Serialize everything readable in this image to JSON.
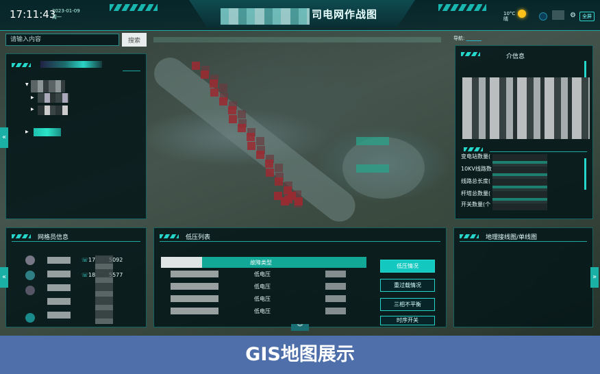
{
  "header": {
    "time": "17:11:43",
    "date": "2023-01-09",
    "weekday": "周一",
    "title_visible": "司电网作战图",
    "temperature": "10°C",
    "weather": "晴",
    "fullscreen_label": "全屏"
  },
  "search": {
    "placeholder": "请输入内容",
    "button_label": "搜索"
  },
  "nav": {
    "label": "导航:"
  },
  "left_panel": {},
  "right_top_panel": {
    "title_visible": "介信息",
    "stats": [
      "变电站数量(",
      "10KV线路数",
      "线路总长度(",
      "杆塔总数量(",
      "开关数量(个"
    ]
  },
  "gridman_panel": {
    "title": "网格员信息",
    "phones": [
      "17",
      "5092",
      "18",
      "5577"
    ]
  },
  "lowvoltage_panel": {
    "title": "低压列表",
    "column_fault_type": "故障类型",
    "rows": [
      "低电压",
      "低电压",
      "低电压",
      "低电压"
    ],
    "buttons": [
      "低压情况",
      "重过载情况",
      "三相不平衡",
      "时序开关"
    ],
    "active_button_index": 0
  },
  "topology_panel": {
    "title": "地理接线图/单线图"
  },
  "caption": "GIS地图展示",
  "colors": {
    "accent": "#1ea9a4",
    "button_active": "#12c8bf",
    "caption_bg": "#4f6fab",
    "alert_red": "#9b2a31"
  }
}
